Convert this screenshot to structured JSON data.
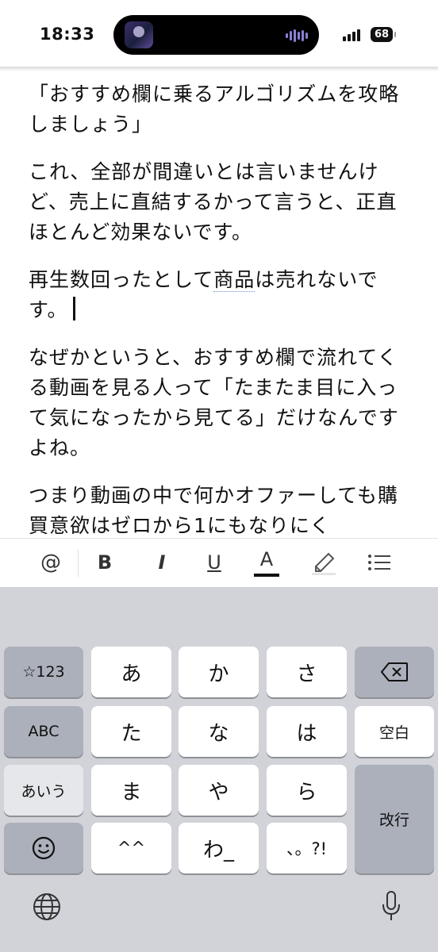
{
  "status_bar": {
    "time": "18:33",
    "battery": "68"
  },
  "editor": {
    "paragraphs": [
      "「おすすめ欄に乗るアルゴリズムを攻略しましょう」",
      "これ、全部が間違いとは言いませんけど、売上に直結するかって言うと、正直ほとんど効果ないです。",
      "なぜかというと、おすすめ欄で流れてくる動画を見る人って「たまたま目に入って気になったから見てる」だけなんですよね。",
      "つまり動画の中で何かオファーしても購買意欲はゼロから1にもなりにく"
    ],
    "p3_before": "再生数回ったとして",
    "p3_underlined": "商品",
    "p3_after": "は売れないです。"
  },
  "toolbar": {
    "mention": "@",
    "bold": "B",
    "italic": "I",
    "underline": "U",
    "text_color": "A",
    "text_color_value": "#111111"
  },
  "keyboard": {
    "left_keys": [
      "☆123",
      "ABC",
      "あいう"
    ],
    "kana_keys": [
      "あ",
      "か",
      "さ",
      "た",
      "な",
      "は",
      "ま",
      "や",
      "ら",
      "^^",
      "わ_",
      "、。?!"
    ],
    "space_label": "空白",
    "return_label": "改行"
  },
  "colors": {
    "keyboard_bg": "#d1d3d9",
    "key_white": "#ffffff",
    "key_gray": "#abb0bb"
  }
}
